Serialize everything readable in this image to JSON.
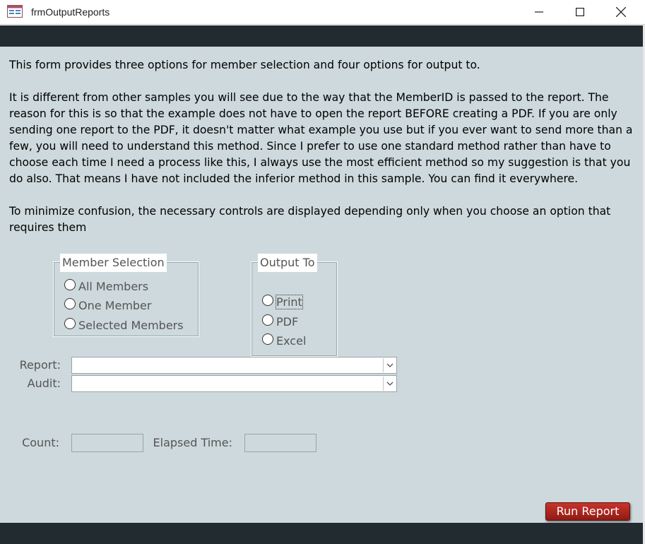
{
  "window": {
    "title": "frmOutputReports"
  },
  "intro": {
    "p1": "This form provides three options for member selection and four options for output to.",
    "p2": "It is different from other samples you will see due to the way that the MemberID is passed to the report.  The reason for this is so that the example does not have to open the report BEFORE creating a PDF.  If you are only sending one report to the PDF, it doesn't matter what example you use but if you ever want to send more than a few, you will need to understand this method.  Since I prefer to use one standard method rather than have to choose each time I need a process like this, I always use the most efficient method so my suggestion is that you do also.  That means I have not included the inferior method in this sample.  You can find it everywhere.",
    "p3": "To minimize confusion, the necessary controls are displayed depending only when you choose an option that requires them"
  },
  "member_selection": {
    "label": "Member Selection",
    "options": [
      "All Members",
      "One Member",
      "Selected Members"
    ]
  },
  "output_to": {
    "label": "Output To",
    "options": [
      "Print",
      "PDF",
      "Excel"
    ]
  },
  "fields": {
    "report_label": "Report:",
    "audit_label": "Audit:",
    "count_label": "Count:",
    "elapsed_label": "Elapsed Time:"
  },
  "buttons": {
    "run_report": "Run Report"
  },
  "icons": {
    "app": "form-icon",
    "minimize": "minimize-icon",
    "maximize": "maximize-icon",
    "close": "close-icon",
    "dropdown": "chevron-down-icon"
  },
  "colors": {
    "form_background": "#cdd9dc",
    "band": "#222b30",
    "button": "#b22a22"
  }
}
